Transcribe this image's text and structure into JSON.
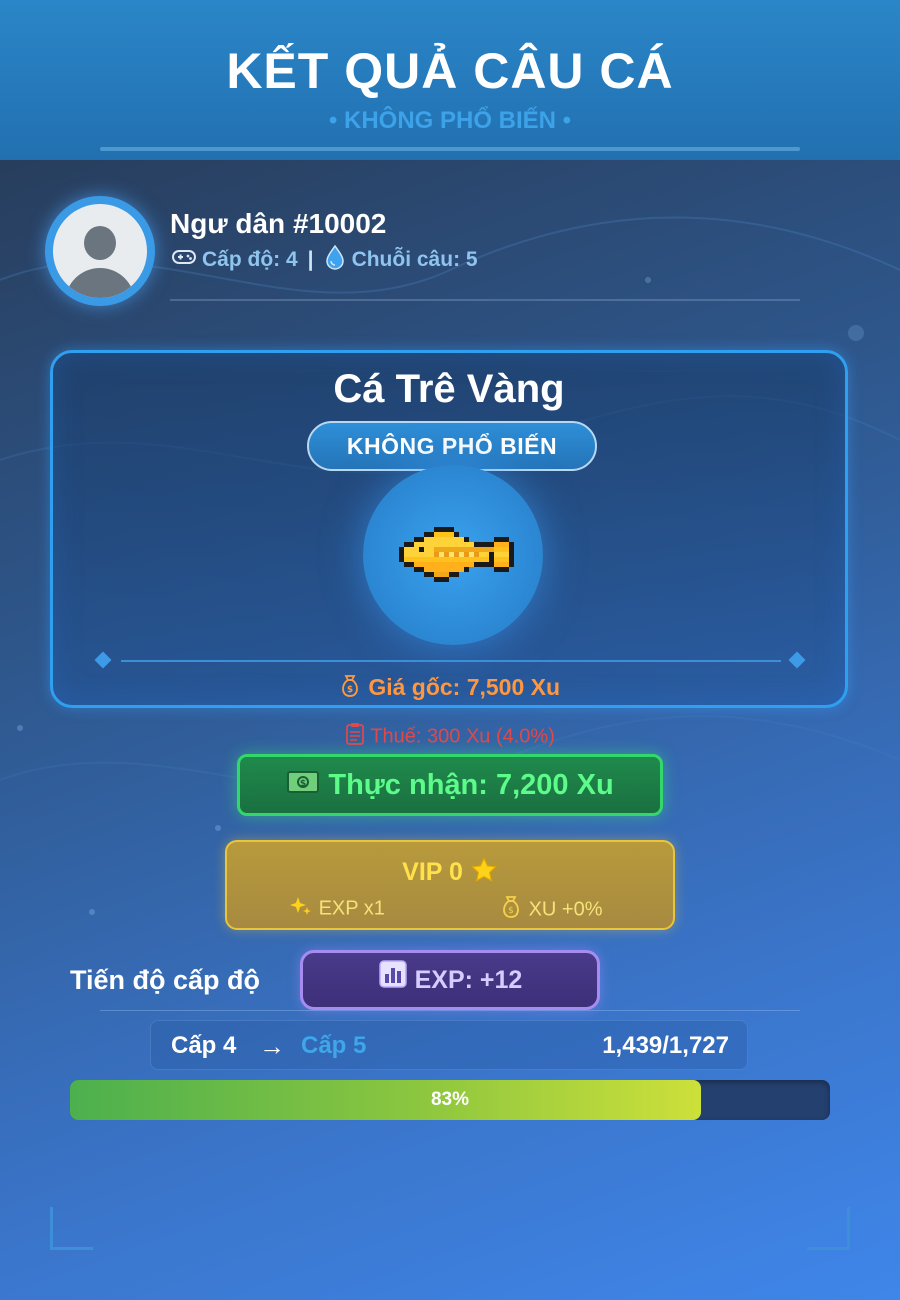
{
  "header": {
    "title": "KẾT QUẢ CÂU CÁ",
    "subtitle": "• KHÔNG PHỔ BIẾN •"
  },
  "player": {
    "name": "Ngư dân #10002",
    "level_text": "Cấp độ: 4",
    "separator": "|",
    "streak_text": "Chuỗi câu: 5"
  },
  "catch": {
    "fish_name": "Cá Trê Vàng",
    "rarity": "KHÔNG PHỔ BIẾN",
    "base_price_text": "Giá gốc: 7,500 Xu"
  },
  "economy": {
    "tax_text": "Thuế: 300 Xu (4.0%)",
    "net_text": "Thực nhận: 7,200 Xu"
  },
  "vip": {
    "title": "VIP 0",
    "exp_bonus": "EXP x1",
    "xu_bonus": "XU +0%"
  },
  "progress": {
    "label": "Tiến độ cấp độ",
    "exp_gain": "EXP: +12",
    "current_level": "Cấp 4",
    "arrow": "→",
    "next_level": "Cấp 5",
    "exp_text": "1,439/1,727",
    "percent": 83,
    "percent_text": "83%"
  },
  "icons": [
    "gamepad-icon",
    "droplet-icon",
    "money-bag-icon",
    "clipboard-icon",
    "cash-icon",
    "star-icon",
    "sparkles-icon",
    "chart-icon"
  ],
  "colors": {
    "accent": "#2f9ff0",
    "base_price": "#ff9640",
    "tax": "#e0484a",
    "net": "#5dfc8a",
    "vip": "#ffe24a",
    "next_level": "#3fa6ea"
  }
}
